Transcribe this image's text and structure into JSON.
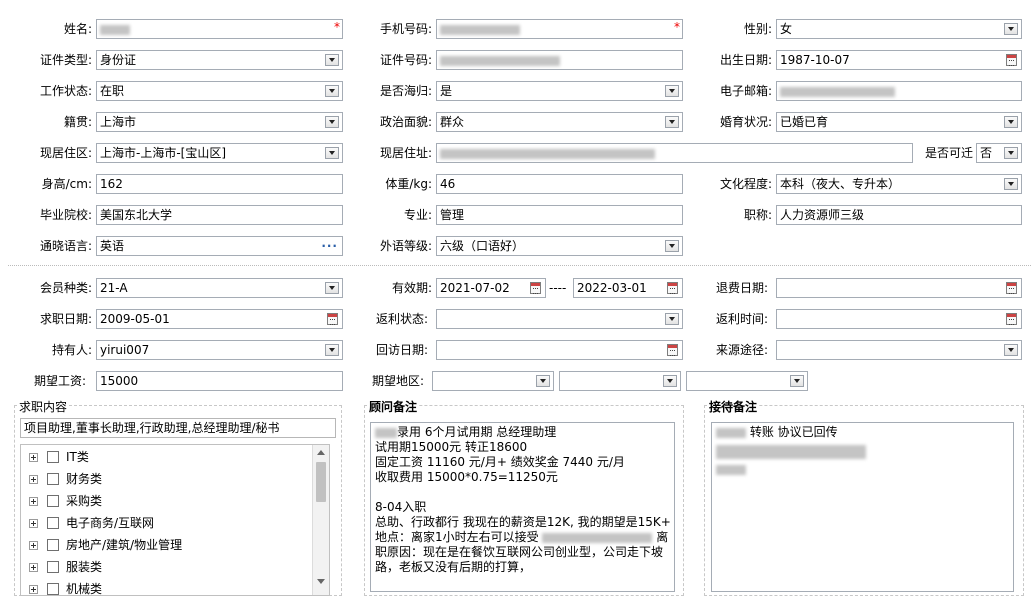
{
  "personal": {
    "name_label": "姓名:",
    "phone_label": "手机号码:",
    "gender_label": "性别:",
    "gender": "女",
    "id_type_label": "证件类型:",
    "id_type": "身份证",
    "id_no_label": "证件号码:",
    "birth_label": "出生日期:",
    "birth": "1987-10-07",
    "work_label": "工作状态:",
    "work": "在职",
    "returnee_label": "是否海归:",
    "returnee": "是",
    "email_label": "电子邮箱:",
    "native_label": "籍贯:",
    "native": "上海市",
    "political_label": "政治面貌:",
    "political": "群众",
    "marital_label": "婚育状况:",
    "marital": "已婚已育",
    "residence_label": "现居住区:",
    "residence": "上海市-上海市-[宝山区]",
    "address_label": "现居住址:",
    "relocate_label": "是否可迁",
    "relocate": "否",
    "height_label": "身高/cm:",
    "height": "162",
    "weight_label": "体重/kg:",
    "weight": "46",
    "edu_label": "文化程度:",
    "edu": "本科（夜大、专升本）",
    "school_label": "毕业院校:",
    "school": "美国东北大学",
    "major_label": "专业:",
    "major": "管理",
    "title_label": "职称:",
    "title": "人力资源师三级",
    "lang_label": "通晓语言:",
    "lang": "英语",
    "foreign_label": "外语等级:",
    "foreign": "六级（口语好）"
  },
  "member": {
    "type_label": "会员种类:",
    "type": "21-A",
    "valid_label": "有效期:",
    "valid_from": "2021-07-02",
    "valid_sep": "----",
    "valid_to": "2022-03-01",
    "refund_date_label": "退费日期:",
    "job_date_label": "求职日期:",
    "job_date": "2009-05-01",
    "rebate_status_label": "返利状态:",
    "rebate_time_label": "返利时间:",
    "holder_label": "持有人:",
    "holder": "yirui007",
    "visit_label": "回访日期:",
    "source_label": "来源途径:",
    "salary_label": "期望工资:",
    "salary": "15000",
    "area_label": "期望地区:"
  },
  "job": {
    "section_title": "求职内容",
    "intent": "项目助理,董事长助理,行政助理,总经理助理/秘书",
    "categories": [
      "IT类",
      "财务类",
      "采购类",
      "电子商务/互联网",
      "房地产/建筑/物业管理",
      "服装类",
      "机械类"
    ]
  },
  "advisor": {
    "section_title": "顾问备注",
    "lines": [
      "录用  6个月试用期    总经理助理",
      "试用期15000元 转正18600",
      "固定工资 11160 元/月+ 绩效奖金 7440 元/月",
      "收取费用 15000*0.75=11250元",
      "",
      "8-04入职",
      "总助、行政都行 我现在的薪资是12K, 我的期望是15K+",
      "地点：离家1小时左右可以接受",
      "职原因：现在是在餐饮互联网公司创业型，公司走下坡",
      "路，老板又没有后期的打算，"
    ],
    "line8_tail": "离"
  },
  "reception": {
    "section_title": "接待备注",
    "line1": "转账 协议已回传"
  }
}
